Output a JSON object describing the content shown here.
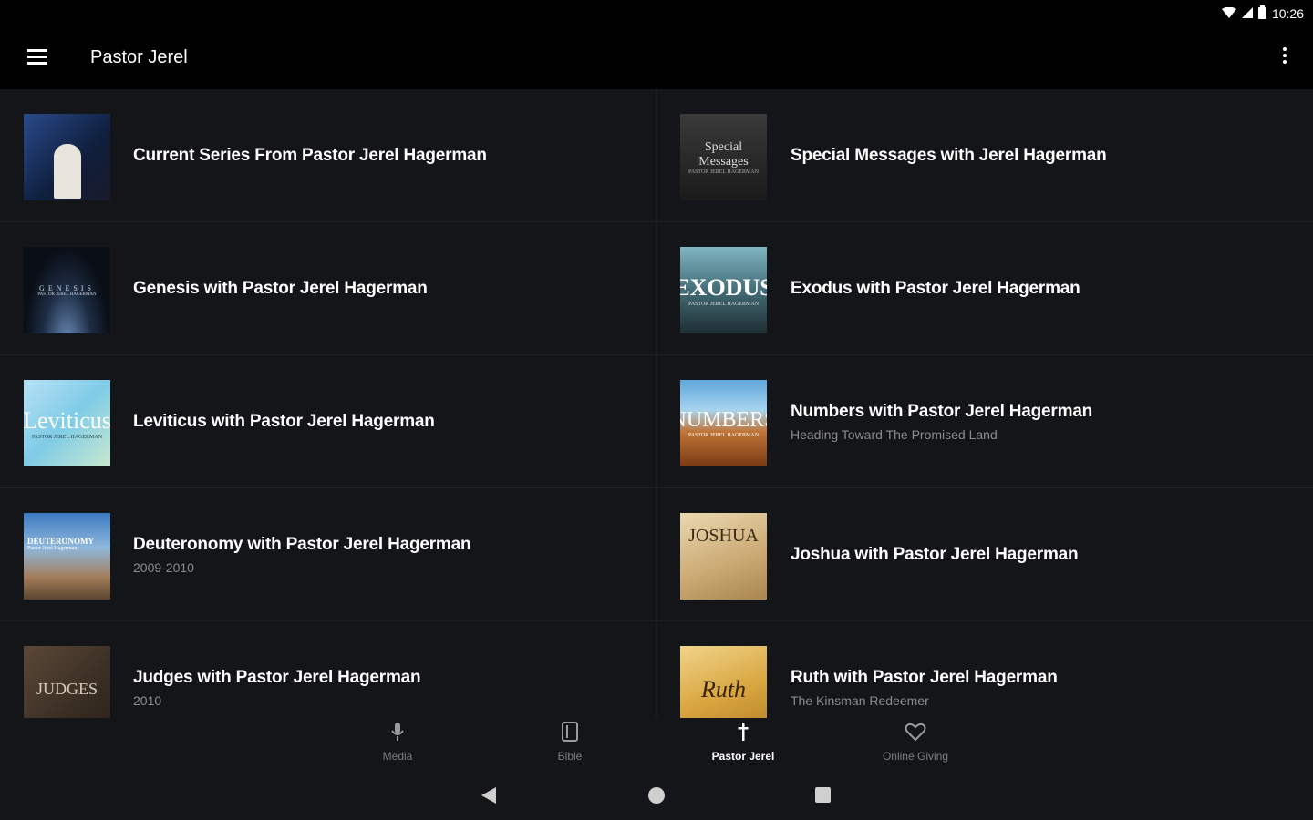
{
  "status_bar": {
    "time": "10:26",
    "icons": [
      "wifi-icon",
      "signal-icon",
      "battery-icon"
    ]
  },
  "app_bar": {
    "title": "Pastor Jerel",
    "menu_icon": "hamburger-menu-icon",
    "overflow_icon": "more-vertical-icon"
  },
  "series": [
    {
      "title": "Current Series From Pastor Jerel Hagerman",
      "subtitle": "",
      "thumb_text": "",
      "thumb_small": ""
    },
    {
      "title": "Special Messages with Jerel Hagerman",
      "subtitle": "",
      "thumb_text": "Special Messages",
      "thumb_small": "PASTOR JEREL HAGERMAN"
    },
    {
      "title": "Genesis with Pastor Jerel Hagerman",
      "subtitle": "",
      "thumb_text": "GENESIS",
      "thumb_small": "PASTOR JEREL HAGERMAN"
    },
    {
      "title": "Exodus with Pastor Jerel Hagerman",
      "subtitle": "",
      "thumb_text": "EXODUS",
      "thumb_small": "PASTOR JEREL HAGERMAN"
    },
    {
      "title": "Leviticus with Pastor Jerel Hagerman",
      "subtitle": "",
      "thumb_text": "Leviticus",
      "thumb_small": "PASTOR JEREL HAGERMAN"
    },
    {
      "title": "Numbers with Pastor Jerel Hagerman",
      "subtitle": "Heading Toward The Promised Land",
      "thumb_text": "NUMBERS",
      "thumb_small": "PASTOR JEREL HAGERMAN"
    },
    {
      "title": "Deuteronomy with Pastor Jerel Hagerman",
      "subtitle": "2009-2010",
      "thumb_text": "DEUTERONOMY",
      "thumb_small": "Pastor Jerel Hagerman"
    },
    {
      "title": "Joshua with Pastor Jerel Hagerman",
      "subtitle": "",
      "thumb_text": "JOSHUA",
      "thumb_small": ""
    },
    {
      "title": "Judges with Pastor Jerel Hagerman",
      "subtitle": "2010",
      "thumb_text": "JUDGES",
      "thumb_small": ""
    },
    {
      "title": "Ruth with Pastor Jerel Hagerman",
      "subtitle": "The Kinsman Redeemer",
      "thumb_text": "Ruth",
      "thumb_small": ""
    }
  ],
  "bottom_nav": [
    {
      "label": "Media",
      "icon": "microphone-icon",
      "active": false
    },
    {
      "label": "Bible",
      "icon": "book-icon",
      "active": false
    },
    {
      "label": "Pastor Jerel",
      "icon": "cross-icon",
      "active": true
    },
    {
      "label": "Online Giving",
      "icon": "heart-icon",
      "active": false
    }
  ],
  "system_nav": [
    "back-icon",
    "home-icon",
    "recents-icon"
  ],
  "colors": {
    "background": "#141518",
    "bar": "#000000",
    "text": "#ffffff",
    "subtext": "#8a8b8f",
    "nav_inactive": "#7e7f83"
  }
}
